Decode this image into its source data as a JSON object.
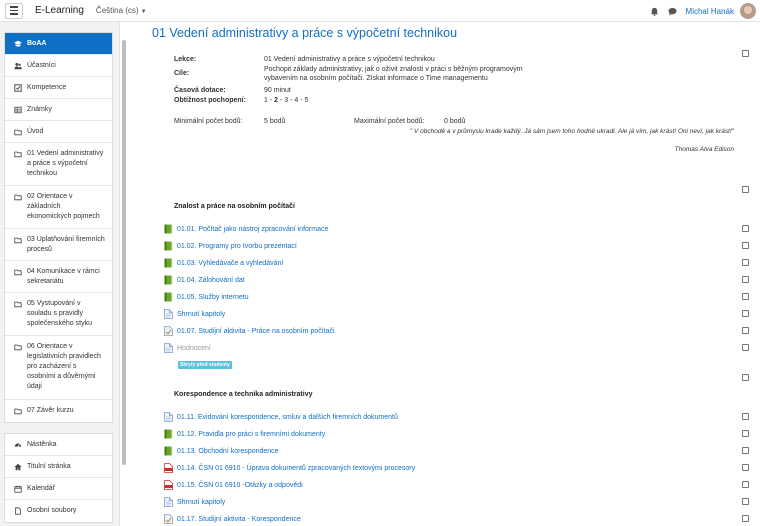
{
  "navbar": {
    "brand": "E-Learning",
    "language": "Čeština (cs)",
    "user_name": "Michal Hanák"
  },
  "sidebar": {
    "course_items": [
      {
        "label": "BoAA",
        "icon": "graduation-cap-icon",
        "active": true
      },
      {
        "label": "Účastníci",
        "icon": "users-icon"
      },
      {
        "label": "Kompetence",
        "icon": "check-square-icon"
      },
      {
        "label": "Známky",
        "icon": "table-icon"
      },
      {
        "label": "Úvod",
        "icon": "folder-icon"
      },
      {
        "label": "01 Vedení administrativy a práce s výpočetní technikou",
        "icon": "folder-icon"
      },
      {
        "label": "02 Orientace v základních ekonomických pojmech",
        "icon": "folder-icon"
      },
      {
        "label": "03 Uplatňování firemních procesů",
        "icon": "folder-icon"
      },
      {
        "label": "04 Komunikace v rámci sekretariátu",
        "icon": "folder-icon"
      },
      {
        "label": "05 Vystupování v souladu s pravidly společenského styku",
        "icon": "folder-icon"
      },
      {
        "label": "06 Orientace v legislativních pravidlech pro zacházení s osobními a důvěrnými údaji",
        "icon": "folder-icon"
      },
      {
        "label": "07 Závěr kurzu",
        "icon": "folder-icon"
      }
    ],
    "site_items": [
      {
        "label": "Nástěnka",
        "icon": "dashboard-icon"
      },
      {
        "label": "Titulní stránka",
        "icon": "home-icon"
      },
      {
        "label": "Kalendář",
        "icon": "calendar-icon"
      },
      {
        "label": "Osobní soubory",
        "icon": "file-icon"
      }
    ]
  },
  "main": {
    "title": "01 Vedení administrativy a práce s výpočetní technikou",
    "info": {
      "lesson_label": "Lekce:",
      "lesson_value": "01 Vedení administrativy a práce s výpočetní technikou",
      "goals_label": "Cíle:",
      "goals_value": "Pochopit základy administrativy, jak o oživit znalosti v práci s běžným programovým vybavením na osobním počítači. Získat informace o Time managementu",
      "time_label": "Časová dotace:",
      "time_value": "90 minut",
      "difficulty_label": "Obtížnost pochopení:",
      "difficulty_1": "1 - ",
      "difficulty_2": "2",
      "difficulty_rest": " - 3 - 4 - 5"
    },
    "stats": {
      "min_label": "Minimální  počet bodů:",
      "min_value": "5 bodů",
      "max_label": "Maximální počet bodů:",
      "max_value": "0 bodů"
    },
    "quote": "\" V obchodě a v průmyslu krade každý. Já sám jsem toho hodně ukradl. Ale já vím, jak krást! Oni neví, jak krást!\"",
    "quote_author": "Thomas Alva Edison",
    "sections": [
      {
        "title": "Znalost a práce na osobním počítači",
        "activities": [
          {
            "label": "01.01. Počítač jako nástroj zpracování informace",
            "icon": "book-icon"
          },
          {
            "label": "01.02. Programy pro tvorbu prezentací",
            "icon": "book-icon"
          },
          {
            "label": "01.03. Vyhledávače a vyhledávání",
            "icon": "book-icon"
          },
          {
            "label": "01.04. Zálohování dat",
            "icon": "book-icon"
          },
          {
            "label": "01.05. Služby internetu",
            "icon": "book-icon"
          },
          {
            "label": "Shrnutí kapitoly",
            "icon": "page-icon"
          },
          {
            "label": "01.07. Studijní aktivita - Práce na osobním počítači",
            "icon": "assignment-icon"
          },
          {
            "label": "Hodnocení",
            "icon": "page-icon",
            "muted": true
          }
        ],
        "badge": "Skrytý před studenty"
      },
      {
        "title": "Korespondence a technika administrativy",
        "activities": [
          {
            "label": "01.11. Evidování korespondence, smluv a dalších firemních dokumentů",
            "icon": "page-icon"
          },
          {
            "label": "01.12. Pravidla pro práci s firemními dokumenty",
            "icon": "book-icon"
          },
          {
            "label": "01.13. Obchodní korespondence",
            "icon": "book-icon"
          },
          {
            "label": "01.14. ČSN 01 6910 - Úprava dokumentů zpracovaných textovými procesory",
            "icon": "pdf-icon"
          },
          {
            "label": "01.15. ČSN 01 6910 -Otázky a odpovědi",
            "icon": "pdf-icon"
          },
          {
            "label": "Shrnutí kapitoly",
            "icon": "page-icon"
          },
          {
            "label": "01.17. Studijní aktivita - Korespondence",
            "icon": "assignment-icon"
          }
        ]
      }
    ]
  }
}
